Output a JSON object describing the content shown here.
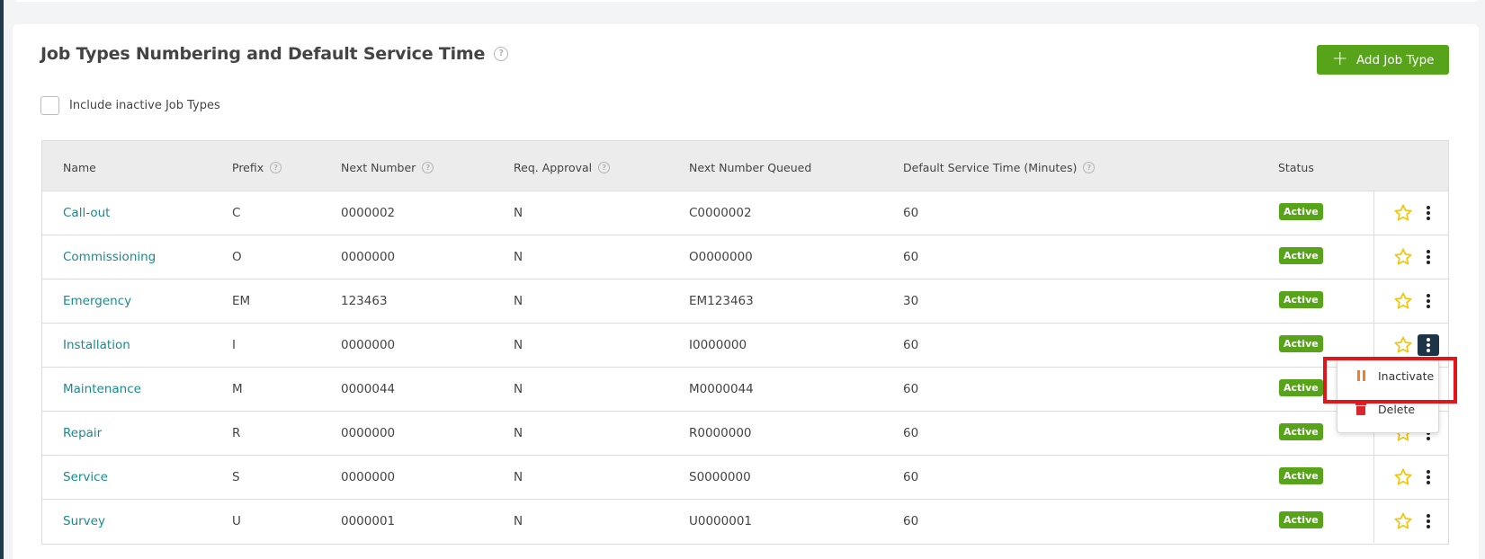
{
  "page": {
    "title": "Job Types Numbering and Default Service Time",
    "add_button_label": "Add Job Type",
    "include_inactive_label": "Include inactive Job Types",
    "include_inactive_checked": false
  },
  "table": {
    "columns": {
      "name": "Name",
      "prefix": "Prefix",
      "next_number": "Next Number",
      "req_approval": "Req. Approval",
      "next_number_queued": "Next Number Queued",
      "default_service_time": "Default Service Time (Minutes)",
      "status": "Status"
    },
    "rows": [
      {
        "name": "Call-out",
        "prefix": "C",
        "next_number": "0000002",
        "req_approval": "N",
        "queued": "C0000002",
        "service_time": "60",
        "status": "Active"
      },
      {
        "name": "Commissioning",
        "prefix": "O",
        "next_number": "0000000",
        "req_approval": "N",
        "queued": "O0000000",
        "service_time": "60",
        "status": "Active"
      },
      {
        "name": "Emergency",
        "prefix": "EM",
        "next_number": "123463",
        "req_approval": "N",
        "queued": "EM123463",
        "service_time": "30",
        "status": "Active"
      },
      {
        "name": "Installation",
        "prefix": "I",
        "next_number": "0000000",
        "req_approval": "N",
        "queued": "I0000000",
        "service_time": "60",
        "status": "Active"
      },
      {
        "name": "Maintenance",
        "prefix": "M",
        "next_number": "0000044",
        "req_approval": "N",
        "queued": "M0000044",
        "service_time": "60",
        "status": "Active"
      },
      {
        "name": "Repair",
        "prefix": "R",
        "next_number": "0000000",
        "req_approval": "N",
        "queued": "R0000000",
        "service_time": "60",
        "status": "Active"
      },
      {
        "name": "Service",
        "prefix": "S",
        "next_number": "0000000",
        "req_approval": "N",
        "queued": "S0000000",
        "service_time": "60",
        "status": "Active"
      },
      {
        "name": "Survey",
        "prefix": "U",
        "next_number": "0000001",
        "req_approval": "N",
        "queued": "U0000001",
        "service_time": "60",
        "status": "Active"
      }
    ]
  },
  "dropdown": {
    "open_for_row": "Installation",
    "items": [
      {
        "label": "Inactivate",
        "icon": "pause-icon"
      },
      {
        "label": "Delete",
        "icon": "trash-icon"
      }
    ]
  },
  "colors": {
    "accent_green": "#57a41a",
    "link_teal": "#1a8a8f",
    "star_yellow": "#f2c500",
    "highlight_red": "#e3151b"
  }
}
